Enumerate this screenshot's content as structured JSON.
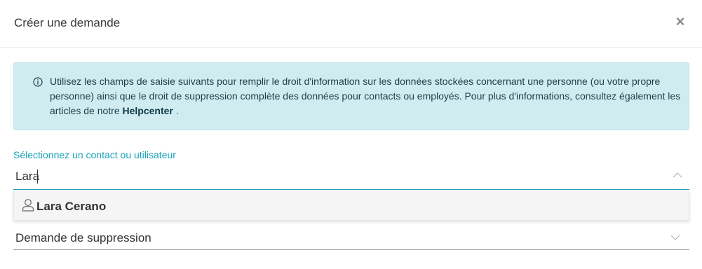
{
  "modal": {
    "title": "Créer une demande",
    "close_label": "×"
  },
  "info": {
    "text": "Utilisez les champs de saisie suivants pour remplir le droit d'information sur les données stockées concernant une personne (ou votre propre personne) ainsi que le droit de suppression complète des données pour contacts ou employés. Pour plus d'informations, consultez également les articles de notre ",
    "link_label": "Helpcenter",
    "suffix": " ."
  },
  "contact_field": {
    "label": "Sélectionnez un contact ou utilisateur",
    "value": "Lara",
    "options": [
      {
        "label": "Lara Cerano",
        "icon": "user-icon"
      }
    ]
  },
  "request_type": {
    "selected": "Demande de suppression"
  },
  "colors": {
    "accent": "#17a2b8",
    "info_bg": "#d1ecf1",
    "info_border": "#bee5eb"
  }
}
